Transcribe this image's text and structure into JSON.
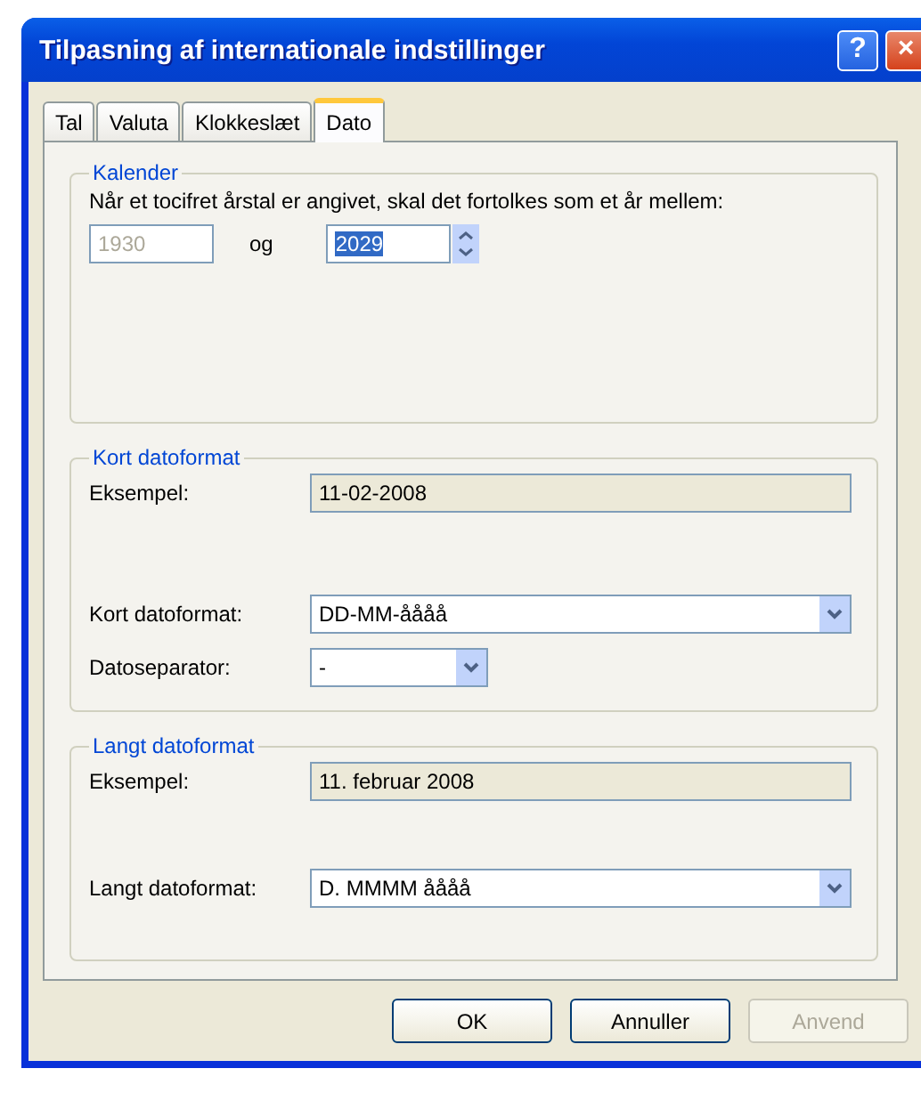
{
  "window": {
    "title": "Tilpasning af internationale indstillinger",
    "help_button": "?",
    "close_button": "×"
  },
  "tabs": [
    {
      "label": "Tal",
      "selected": false
    },
    {
      "label": "Valuta",
      "selected": false
    },
    {
      "label": "Klokkeslæt",
      "selected": false
    },
    {
      "label": "Dato",
      "selected": true
    }
  ],
  "calendar": {
    "legend": "Kalender",
    "description": "Når et tocifret årstal er angivet, skal det fortolkes som et år mellem:",
    "from_year": {
      "value": "1930",
      "disabled": true
    },
    "and_label": "og",
    "to_year": {
      "value": "2029",
      "selected": true
    }
  },
  "short_format": {
    "legend": "Kort datoformat",
    "example_label": "Eksempel:",
    "example_value": "11-02-2008",
    "format_label": "Kort datoformat:",
    "format_value": "DD-MM-åååå",
    "separator_label": "Datoseparator:",
    "separator_value": "-"
  },
  "long_format": {
    "legend": "Langt datoformat",
    "example_label": "Eksempel:",
    "example_value": "11. februar 2008",
    "format_label": "Langt datoformat:",
    "format_value": "D. MMMM åååå"
  },
  "buttons": [
    {
      "label": "OK",
      "disabled": false
    },
    {
      "label": "Annuller",
      "disabled": false
    },
    {
      "label": "Anvend",
      "disabled": true
    }
  ]
}
